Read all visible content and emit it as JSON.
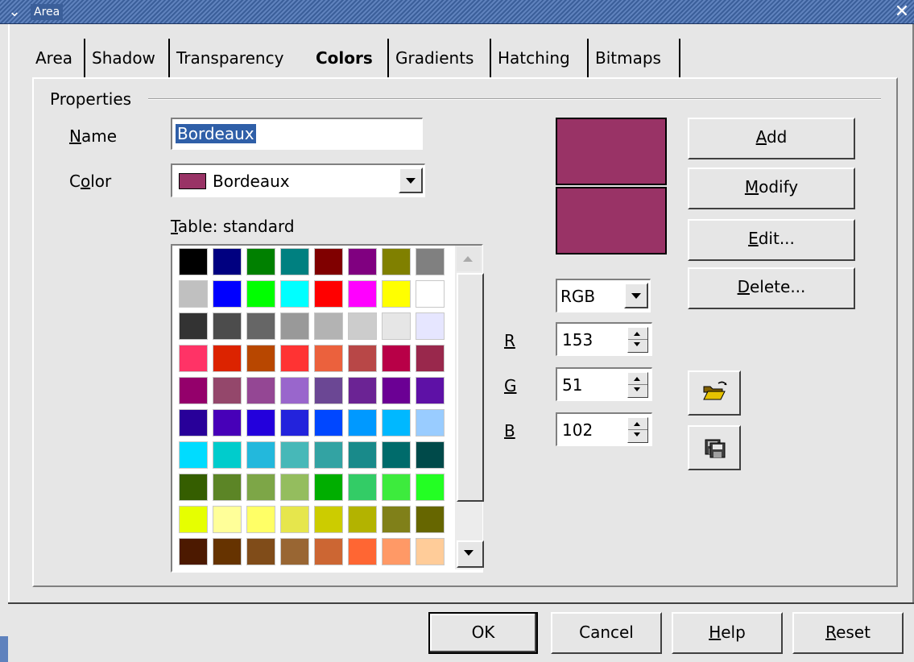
{
  "window": {
    "title": "Area",
    "menu_glyph": "⌄",
    "close_glyph": "✕"
  },
  "tabs": [
    {
      "label": "Area",
      "active": false
    },
    {
      "label": "Shadow",
      "active": false
    },
    {
      "label": "Transparency",
      "active": false
    },
    {
      "label": "Colors",
      "active": true
    },
    {
      "label": "Gradients",
      "active": false
    },
    {
      "label": "Hatching",
      "active": false
    },
    {
      "label": "Bitmaps",
      "active": false
    }
  ],
  "properties": {
    "group_label": "Properties",
    "name_label_mn": "N",
    "name_label_rest": "ame",
    "name_value": "Bordeaux",
    "color_label_pre": "C",
    "color_label_mn": "o",
    "color_label_rest": "lor",
    "color_value": "Bordeaux",
    "color_value_hex": "#993366",
    "table_label_mn": "T",
    "table_label_rest": "able: standard"
  },
  "palette": [
    [
      "#000000",
      "#000080",
      "#008000",
      "#008080",
      "#800000",
      "#800080",
      "#808000",
      "#808080"
    ],
    [
      "#c0c0c0",
      "#0000ff",
      "#00ff00",
      "#00ffff",
      "#ff0000",
      "#ff00ff",
      "#ffff00",
      "#ffffff"
    ],
    [
      "#333333",
      "#4c4c4c",
      "#666666",
      "#999999",
      "#b3b3b3",
      "#cccccc",
      "#e6e6e6",
      "#e6e6ff"
    ],
    [
      "#ff3366",
      "#dc2300",
      "#b84700",
      "#ff3333",
      "#eb613d",
      "#b84747",
      "#b80047",
      "#99284c"
    ],
    [
      "#94006b",
      "#94476b",
      "#944794",
      "#9966cc",
      "#6b4794",
      "#6b2394",
      "#6b0094",
      "#5e11a6"
    ],
    [
      "#280099",
      "#4700b8",
      "#2300dc",
      "#2323dc",
      "#0047ff",
      "#0099ff",
      "#00b8ff",
      "#99ccff"
    ],
    [
      "#00dcff",
      "#00cccc",
      "#23b8dc",
      "#47b8b8",
      "#33a3a3",
      "#198a8a",
      "#006b6b",
      "#004a4a"
    ],
    [
      "#355e00",
      "#5c8526",
      "#7da647",
      "#94bd5e",
      "#00ae00",
      "#33cc66",
      "#3deb3d",
      "#23ff23"
    ],
    [
      "#e6ff00",
      "#ffff99",
      "#ffff66",
      "#e6e64c",
      "#cccc00",
      "#b3b300",
      "#808019",
      "#666600"
    ],
    [
      "#4c1900",
      "#663300",
      "#804c19",
      "#996633",
      "#cc6633",
      "#ff6633",
      "#ff9966",
      "#ffcc99"
    ]
  ],
  "preview": {
    "old_color": "#993366",
    "new_color": "#993366"
  },
  "color_model": {
    "value": "RGB"
  },
  "rgb": {
    "r_label": "R",
    "r_value": "153",
    "g_label": "G",
    "g_value": "51",
    "b_label": "B",
    "b_value": "102"
  },
  "side_buttons": {
    "add_mn": "A",
    "add_rest": "dd",
    "modify_mn": "M",
    "modify_rest": "odify",
    "edit_mn": "E",
    "edit_rest": "dit...",
    "delete_mn": "D",
    "delete_rest": "elete..."
  },
  "icons": {
    "open": "folder-open-icon",
    "save": "save-icon"
  },
  "footer": {
    "ok": "OK",
    "cancel": "Cancel",
    "help_mn": "H",
    "help_rest": "elp",
    "reset_mn": "R",
    "reset_rest": "eset"
  }
}
